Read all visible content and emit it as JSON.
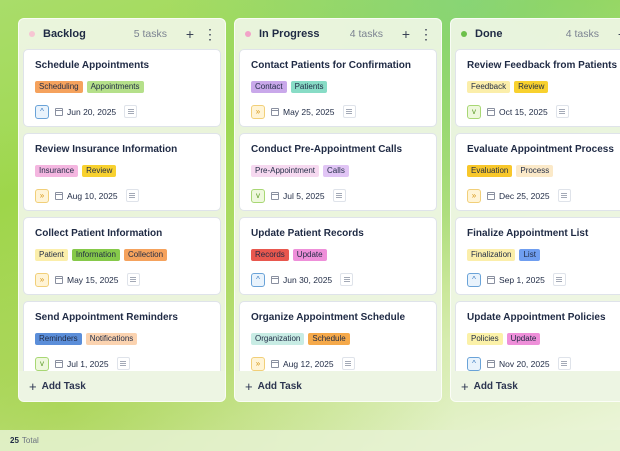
{
  "columns": [
    {
      "title": "Backlog",
      "count": "5 tasks",
      "dot_color": "#f6c6d3",
      "add_icon": "+",
      "more_icon": "⋮",
      "add_label": "Add Task",
      "cards": [
        {
          "title": "Schedule Appointments",
          "tags": [
            {
              "label": "Scheduling",
              "color": "#f5a25d"
            },
            {
              "label": "Appointments",
              "color": "#b5e08a"
            }
          ],
          "priority": "up",
          "date": "Jun 20, 2025"
        },
        {
          "title": "Review Insurance Information",
          "tags": [
            {
              "label": "Insurance",
              "color": "#f4b6e0"
            },
            {
              "label": "Review",
              "color": "#f8d12f"
            }
          ],
          "priority": "high",
          "date": "Aug 10, 2025"
        },
        {
          "title": "Collect Patient Information",
          "tags": [
            {
              "label": "Patient",
              "color": "#fbeeaa"
            },
            {
              "label": "Information",
              "color": "#86c94a"
            },
            {
              "label": "Collection",
              "color": "#f5a25d"
            }
          ],
          "priority": "high",
          "date": "May 15, 2025"
        },
        {
          "title": "Send Appointment Reminders",
          "tags": [
            {
              "label": "Reminders",
              "color": "#5b8ed9"
            },
            {
              "label": "Notifications",
              "color": "#fbd3b0"
            }
          ],
          "priority": "down",
          "date": "Jul 1, 2025"
        }
      ]
    },
    {
      "title": "In Progress",
      "count": "4 tasks",
      "dot_color": "#f2a3c8",
      "add_icon": "+",
      "more_icon": "⋮",
      "add_label": "Add Task",
      "cards": [
        {
          "title": "Contact Patients for Confirmation",
          "tags": [
            {
              "label": "Contact",
              "color": "#c9a8ea"
            },
            {
              "label": "Patients",
              "color": "#88dcc6"
            }
          ],
          "priority": "high",
          "date": "May 25, 2025"
        },
        {
          "title": "Conduct Pre-Appointment Calls",
          "tags": [
            {
              "label": "Pre-Appointment",
              "color": "#f6d9f0"
            },
            {
              "label": "Calls",
              "color": "#e1c5f5"
            }
          ],
          "priority": "down",
          "date": "Jul 5, 2025"
        },
        {
          "title": "Update Patient Records",
          "tags": [
            {
              "label": "Records",
              "color": "#e8574e"
            },
            {
              "label": "Update",
              "color": "#ee8fd9"
            }
          ],
          "priority": "up",
          "date": "Jun 30, 2025"
        },
        {
          "title": "Organize Appointment Schedule",
          "tags": [
            {
              "label": "Organization",
              "color": "#c8ece4"
            },
            {
              "label": "Schedule",
              "color": "#f5a94a"
            }
          ],
          "priority": "high",
          "date": "Aug 12, 2025"
        }
      ]
    },
    {
      "title": "Done",
      "count": "4 tasks",
      "dot_color": "#6cc04a",
      "add_icon": "+",
      "more_icon": "⋮",
      "add_label": "Add Task",
      "cards": [
        {
          "title": "Review Feedback from Patients",
          "tags": [
            {
              "label": "Feedback",
              "color": "#fbeeaa"
            },
            {
              "label": "Review",
              "color": "#f8d12f"
            }
          ],
          "priority": "down",
          "date": "Oct 15, 2025"
        },
        {
          "title": "Evaluate Appointment Process",
          "tags": [
            {
              "label": "Evaluation",
              "color": "#f8c72a"
            },
            {
              "label": "Process",
              "color": "#fbe9c8"
            }
          ],
          "priority": "high",
          "date": "Dec 25, 2025"
        },
        {
          "title": "Finalize Appointment List",
          "tags": [
            {
              "label": "Finalization",
              "color": "#fbeeaa"
            },
            {
              "label": "List",
              "color": "#6f9ef0"
            }
          ],
          "priority": "up",
          "date": "Sep 1, 2025"
        },
        {
          "title": "Update Appointment Policies",
          "tags": [
            {
              "label": "Policies",
              "color": "#fbf1a8"
            },
            {
              "label": "Update",
              "color": "#ee8fd9"
            }
          ],
          "priority": "up",
          "date": "Nov 20, 2025"
        }
      ]
    }
  ],
  "priority_icons": {
    "up": "^",
    "high": "»",
    "down": "v"
  },
  "footer": {
    "total_count": "25",
    "total_label": "Total"
  }
}
